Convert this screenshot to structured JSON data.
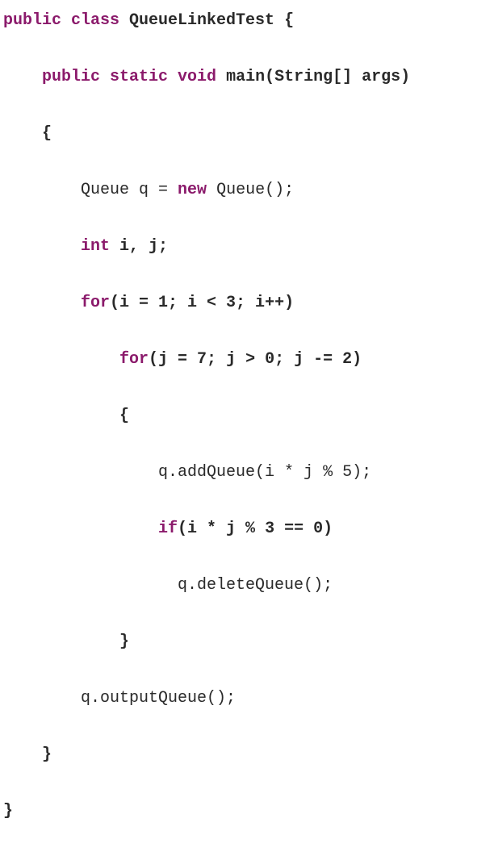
{
  "code": {
    "l1": {
      "t1": "public class ",
      "t2": "QueueLinkedTest {"
    },
    "l2": {
      "t1": "    ",
      "t2": "public static void ",
      "t3": "main(String[] args)"
    },
    "l3": {
      "t1": "    {"
    },
    "l4": {
      "t1": "        Queue q = ",
      "t2": "new ",
      "t3": "Queue();"
    },
    "l5": {
      "t1": "        ",
      "t2": "int ",
      "t3": "i, j;"
    },
    "l6": {
      "t1": "        ",
      "t2": "for",
      "t3": "(i = 1; i < 3; i++)"
    },
    "l7": {
      "t1": "            ",
      "t2": "for",
      "t3": "(j = 7; j > 0; j -= 2)"
    },
    "l8": {
      "t1": "            {"
    },
    "l9": {
      "t1": "                q.addQueue(i * j % 5);"
    },
    "l10": {
      "t1": "                ",
      "t2": "if",
      "t3": "(i * j % 3 == 0)"
    },
    "l11": {
      "t1": "                  q.deleteQueue();"
    },
    "l12": {
      "t1": "            }"
    },
    "l13": {
      "t1": "        q.outputQueue();"
    },
    "l14": {
      "t1": "    }"
    },
    "l15": {
      "t1": "}"
    }
  }
}
